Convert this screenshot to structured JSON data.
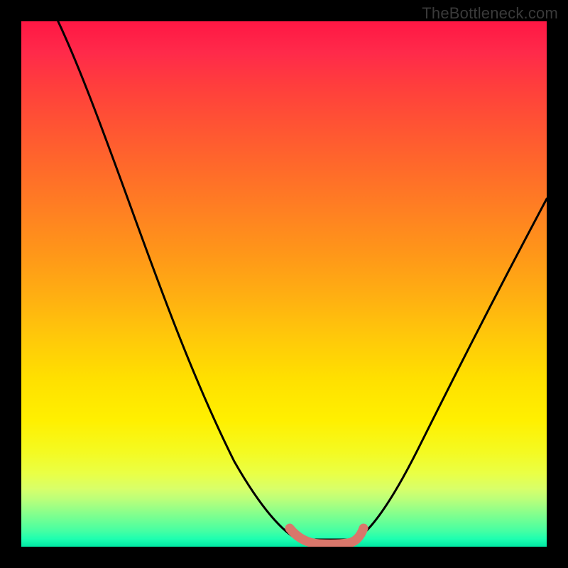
{
  "attribution": "TheBottleneck.com",
  "chart_data": {
    "type": "line",
    "title": "",
    "xlabel": "",
    "ylabel": "",
    "ylim": [
      0,
      100
    ],
    "xlim": [
      0,
      100
    ],
    "series": [
      {
        "name": "bottleneck-curve",
        "x": [
          7,
          12,
          18,
          24,
          30,
          36,
          42,
          48,
          51,
          54,
          57,
          61,
          64,
          70,
          76,
          82,
          88,
          94,
          100
        ],
        "y": [
          100,
          90,
          79,
          68,
          56,
          44,
          32,
          19,
          10,
          3,
          0,
          0,
          3,
          13,
          25,
          36,
          47,
          57,
          66
        ]
      }
    ],
    "highlight": {
      "name": "optimal-band",
      "x": [
        51,
        53,
        55,
        57,
        59,
        61,
        63
      ],
      "y": [
        3.5,
        2,
        1,
        0.5,
        0.5,
        1,
        3
      ]
    },
    "background_gradient": {
      "top": "#ff1744",
      "mid": "#ffe000",
      "bottom": "#00e8a3"
    }
  }
}
